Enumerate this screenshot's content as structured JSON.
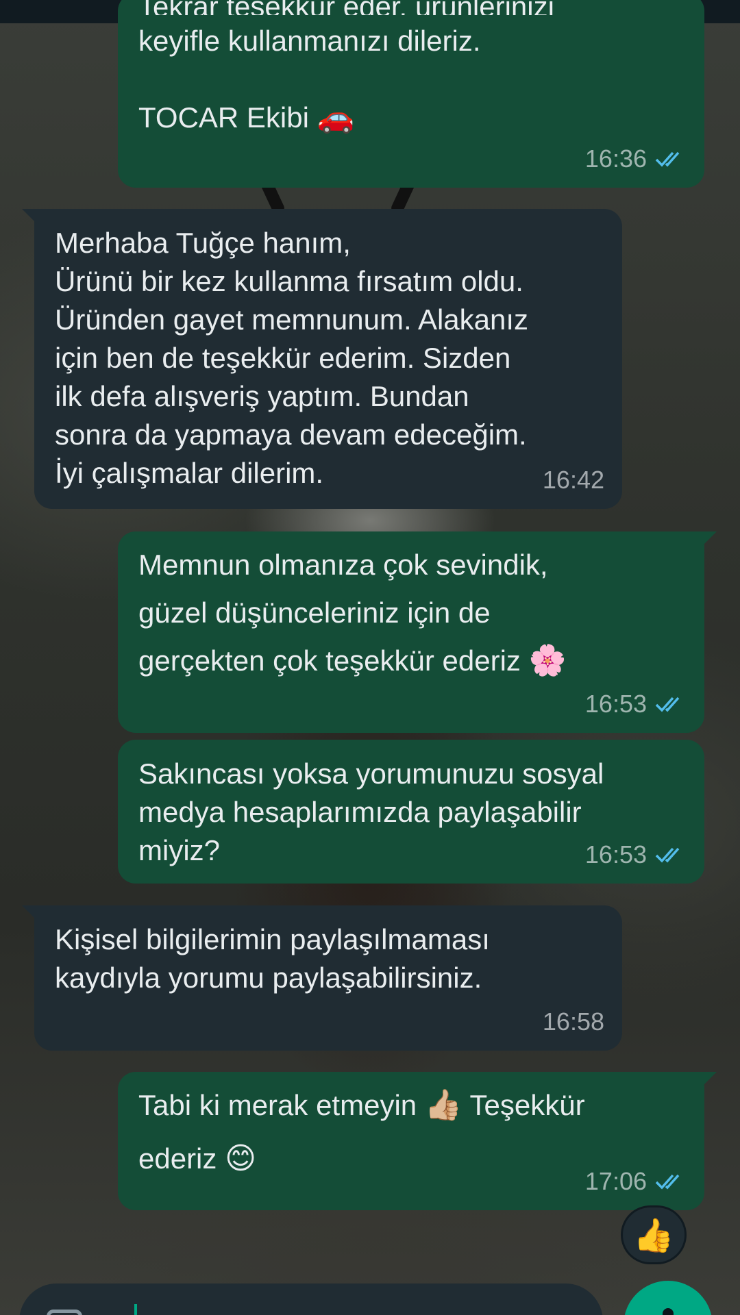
{
  "messages": [
    {
      "direction": "out",
      "text_partial_top": "Tekrar teşekkür eder, ürünlerinizi",
      "text": "keyifle kullanmanızı dileriz.\n\nTOCAR Ekibi",
      "emoji": "🚗",
      "time": "16:36",
      "status": "read"
    },
    {
      "direction": "in",
      "text": "Merhaba Tuğçe hanım,\nÜrünü bir kez kullanma fırsatım oldu.\nÜründen gayet memnunum. Alakanız\niçin ben de teşekkür ederim. Sizden\nilk defa alışveriş yaptım. Bundan\nsonra da yapmaya devam edeceğim.\nİyi çalışmalar dilerim.",
      "time": "16:42"
    },
    {
      "direction": "out",
      "text": "Memnun olmanıza çok sevindik,\ngüzel düşünceleriniz için de\ngerçekten çok teşekkür ederiz",
      "emoji": "🌸",
      "time": "16:53",
      "status": "read"
    },
    {
      "direction": "out",
      "text": "Sakıncası yoksa yorumunuzu sosyal\nmedya hesaplarımızda paylaşabilir\nmiyiz?",
      "time": "16:53",
      "status": "read"
    },
    {
      "direction": "in",
      "text": "Kişisel bilgilerimin paylaşılmaması\nkaydıyla yorumu paylaşabilirsiniz.",
      "time": "16:58"
    },
    {
      "direction": "out",
      "text_line1": "Tabi ki merak etmeyin",
      "emoji1": "👍🏼",
      "text_line1b": "Teşekkür",
      "text_line2": "ederiz",
      "emoji2": "😊",
      "time": "17:06",
      "status": "read"
    }
  ],
  "reaction": {
    "emoji": "👍"
  },
  "colors": {
    "outgoing_bubble": "#144d37",
    "incoming_bubble": "#202c33",
    "read_ticks": "#53bdeb",
    "accent": "#00a884"
  },
  "icons": {
    "read_receipt": "double-check-icon",
    "emoji_button": "emoji-icon",
    "mic_button": "mic-icon"
  }
}
